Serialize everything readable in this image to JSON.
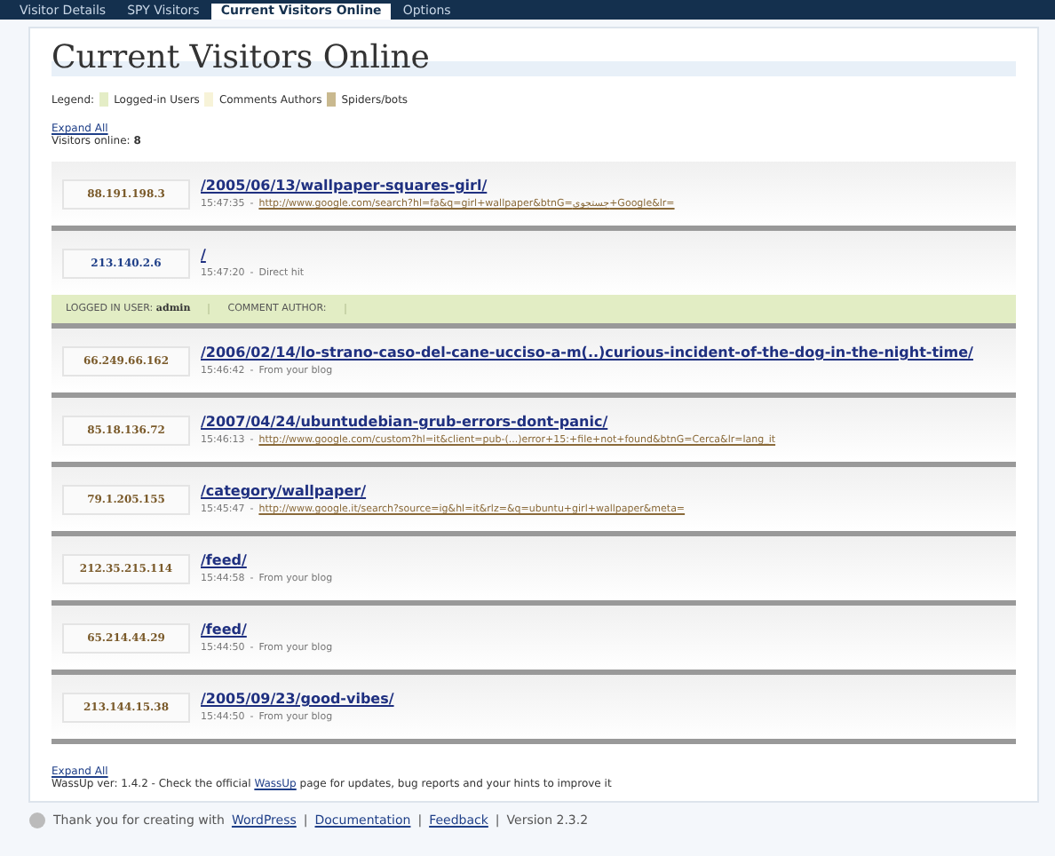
{
  "tabs": [
    {
      "label": "Visitor Details",
      "selected": false
    },
    {
      "label": "SPY Visitors",
      "selected": false
    },
    {
      "label": "Current Visitors Online",
      "selected": true
    },
    {
      "label": "Options",
      "selected": false
    }
  ],
  "title": "Current Visitors Online",
  "legend": {
    "label": "Legend:",
    "items": [
      {
        "label": "Logged-in Users",
        "color": "#e4edc6"
      },
      {
        "label": "Comments Authors",
        "color": "#f7f3d8"
      },
      {
        "label": "Spiders/bots",
        "color": "#c9b98f"
      }
    ]
  },
  "expand_all_top": "Expand All",
  "meta_separator": "-",
  "visitors_online": {
    "label": "Visitors online:",
    "count": "8"
  },
  "visitors": [
    {
      "ip": "88.191.198.3",
      "logged_in": false,
      "path": "/2005/06/13/wallpaper-squares-girl/",
      "time": "15:47:35",
      "referrer": {
        "kind": "link",
        "text": "http://www.google.com/search?hl=fa&q=girl+wallpaper&btnG=جستجوی+Google&lr="
      }
    },
    {
      "ip": "213.140.2.6",
      "logged_in": true,
      "path": "/",
      "time": "15:47:20",
      "referrer": {
        "kind": "plain",
        "text": "Direct hit"
      },
      "user_label": "LOGGED IN USER:",
      "user": "admin",
      "comment_label": "COMMENT AUTHOR:"
    },
    {
      "ip": "66.249.66.162",
      "logged_in": false,
      "path": "/2006/02/14/lo-strano-caso-del-cane-ucciso-a-m(..)curious-incident-of-the-dog-in-the-night-time/",
      "time": "15:46:42",
      "referrer": {
        "kind": "plain",
        "text": "From your blog"
      }
    },
    {
      "ip": "85.18.136.72",
      "logged_in": false,
      "path": "/2007/04/24/ubuntudebian-grub-errors-dont-panic/",
      "time": "15:46:13",
      "referrer": {
        "kind": "link",
        "text": "http://www.google.com/custom?hl=it&client=pub-(...)error+15:+file+not+found&btnG=Cerca&lr=lang_it"
      }
    },
    {
      "ip": "79.1.205.155",
      "logged_in": false,
      "path": "/category/wallpaper/",
      "time": "15:45:47",
      "referrer": {
        "kind": "link",
        "text": "http://www.google.it/search?source=ig&hl=it&rlz=&q=ubuntu+girl+wallpaper&meta="
      }
    },
    {
      "ip": "212.35.215.114",
      "logged_in": false,
      "path": "/feed/",
      "time": "15:44:58",
      "referrer": {
        "kind": "plain",
        "text": "From your blog"
      }
    },
    {
      "ip": "65.214.44.29",
      "logged_in": false,
      "path": "/feed/",
      "time": "15:44:50",
      "referrer": {
        "kind": "plain",
        "text": "From your blog"
      }
    },
    {
      "ip": "213.144.15.38",
      "logged_in": false,
      "path": "/2005/09/23/good-vibes/",
      "time": "15:44:50",
      "referrer": {
        "kind": "plain",
        "text": "From your blog"
      }
    }
  ],
  "expand_all_bottom": "Expand All",
  "version_note": {
    "before": "WassUp ver: 1.4.2 - Check the official",
    "link": "WassUp",
    "after": "page for updates, bug reports and your hints to improve it"
  },
  "footer": {
    "text": "Thank you for creating with",
    "links": [
      "WordPress",
      "Documentation",
      "Feedback"
    ],
    "separator": "|",
    "version": "Version 2.3.2"
  }
}
